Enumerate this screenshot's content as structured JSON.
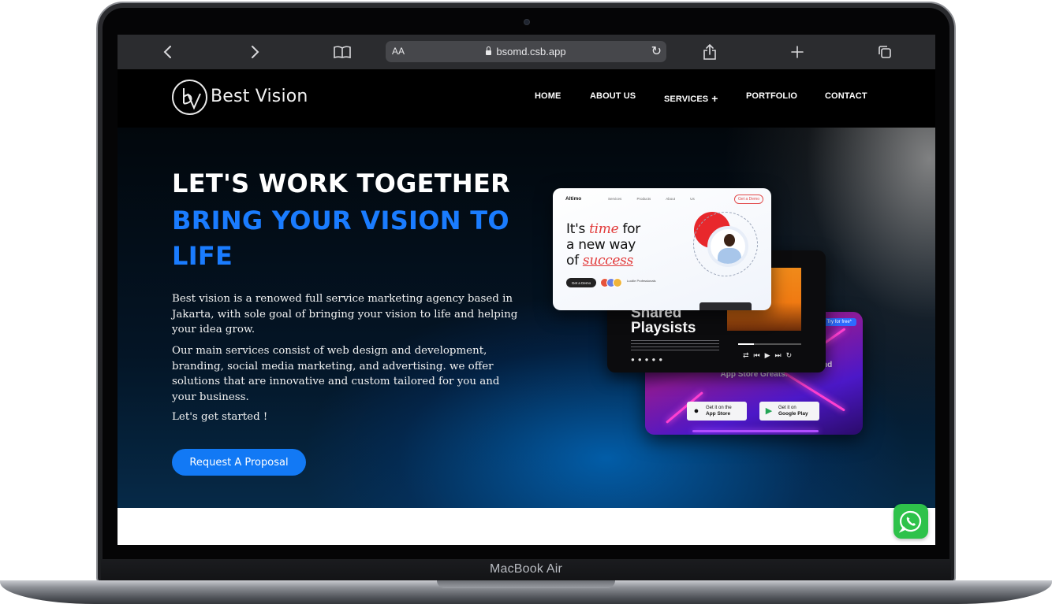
{
  "device": {
    "label": "MacBook Air"
  },
  "browser": {
    "address_text_size": "AA",
    "url": "bsomd.csb.app",
    "icons": [
      "back-icon",
      "forward-icon",
      "bookmarks-icon",
      "lock-icon",
      "reload-icon",
      "share-icon",
      "new-tab-icon",
      "tabs-icon"
    ]
  },
  "site": {
    "brand": "Best Vision",
    "nav": {
      "home": "HOME",
      "about": "ABOUT US",
      "services": "SERVICES",
      "services_plus": "+",
      "portfolio": "PORTFOLIO",
      "contact": "CONTACT"
    },
    "hero": {
      "headline": "LET'S WORK TOGETHER",
      "subheadline": "BRING YOUR VISION TO LIFE",
      "paragraph1": "Best vision is a renowed full service marketing agency based in Jakarta, with sole goal of bringing your vision to life and helping your idea grow.",
      "paragraph2": "Our main services consist of web design and development, branding, social media marketing, and advertising. we offer solutions that are innovative and custom tailored for you and your business.",
      "paragraph3": "Let's get started !",
      "cta": "Request A Proposal"
    },
    "mockups": {
      "web": {
        "logo": "Altimo",
        "nav": "Services Products About Us",
        "top_cta": "Get a Demo",
        "headline_1": "It's ",
        "headline_time": "time",
        "headline_2": " for",
        "headline_3": "a new way",
        "headline_4": "of ",
        "headline_success": "success",
        "button": "Get a Demo",
        "small_text": "Lucille Professionals"
      },
      "music": {
        "title_1": "Shared",
        "title_2": "Playsists"
      },
      "app": {
        "try_button": "Try for free*",
        "side_text": "nd",
        "tagline": "App Store Greats.",
        "appstore_small": "Get it on the",
        "appstore_big": "App Store",
        "googleplay_small": "Get it on",
        "googleplay_big": "Google Play"
      }
    },
    "colors": {
      "accent_blue": "#1a7cff",
      "button_blue": "#1279f5",
      "whatsapp_green": "#2ec24a"
    }
  }
}
